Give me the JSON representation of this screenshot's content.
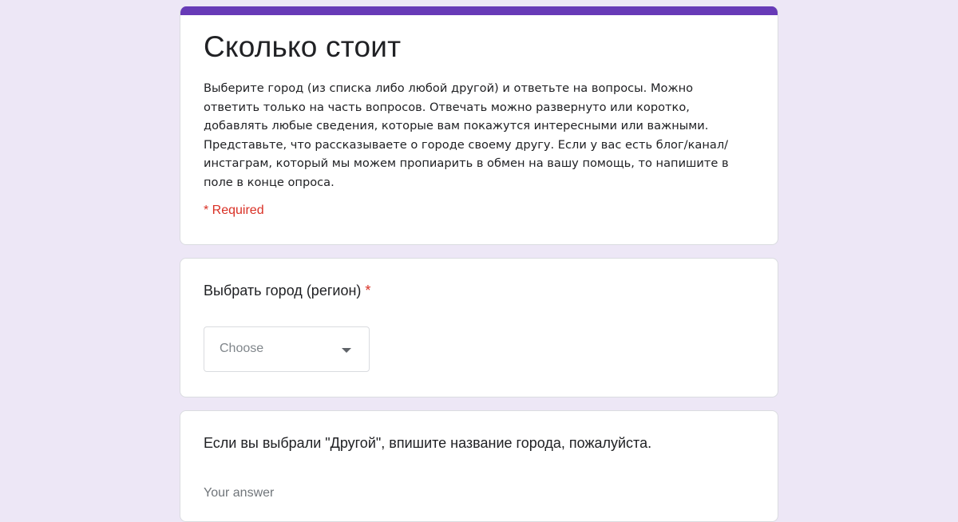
{
  "form": {
    "title": "Сколько стоит",
    "description": "Выберите город (из списка либо любой другой) и ответьте на вопросы. Можно ответить только на часть вопросов. Отвечать можно развернуто или коротко, добавлять любые сведения, которые вам покажутся интересными или важными. Представьте, что рассказываете о городе своему другу. Если у вас есть блог/канал/инстаграм, который мы можем пропиарить в обмен на вашу помощь, то напишите в поле в конце опроса.",
    "required_note": "* Required",
    "accent_color": "#673ab7",
    "background_color": "#ede7f6",
    "required_color": "#d93025"
  },
  "questions": [
    {
      "title": "Выбрать город (регион)",
      "required_mark": "*",
      "dropdown_value": "Choose",
      "icon": "dropdown-arrow-icon"
    },
    {
      "title": "Если вы выбрали \"Другой\", впишите название города, пожалуйста.",
      "answer_placeholder": "Your answer"
    }
  ]
}
